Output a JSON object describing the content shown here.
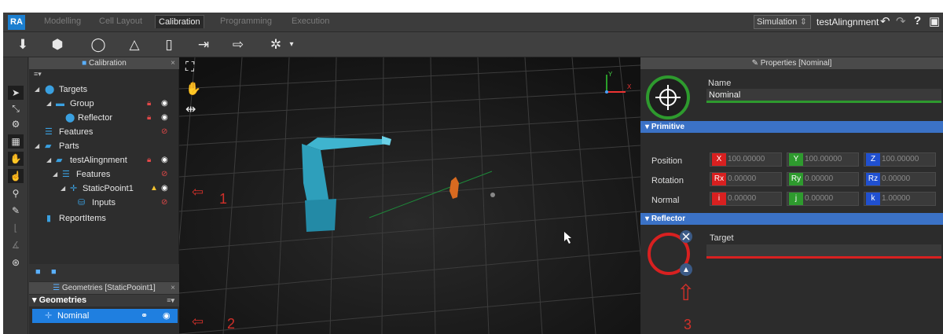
{
  "app": {
    "logo": "RA"
  },
  "tabs": [
    "Modelling",
    "Cell Layout",
    "Calibration",
    "Programming",
    "Execution"
  ],
  "active_tab": "Calibration",
  "mode_select": {
    "value": "Simulation"
  },
  "project_name": "testAlingnment",
  "calibration_panel": {
    "title": "Calibration",
    "tree": [
      {
        "label": "Targets",
        "level": 0
      },
      {
        "label": "Group",
        "level": 1
      },
      {
        "label": "Reflector",
        "level": 2
      },
      {
        "label": "Features",
        "level": 1
      },
      {
        "label": "Parts",
        "level": 0
      },
      {
        "label": "testAlingnment",
        "level": 1
      },
      {
        "label": "Features",
        "level": 2
      },
      {
        "label": "StaticPooint1",
        "level": 3
      },
      {
        "label": "Inputs",
        "level": 4
      },
      {
        "label": "ReportItems",
        "level": 1
      }
    ]
  },
  "geometries_panel": {
    "title": "Geometries [StaticPooint1]",
    "section": "Geometries",
    "items": [
      {
        "label": "Nominal"
      }
    ]
  },
  "properties": {
    "title": "Properties [Nominal]",
    "name_label": "Name",
    "name_value": "Nominal",
    "primitive": {
      "title": "Primitive",
      "position": {
        "label": "Position",
        "x": "100.00000",
        "y": "100.00000",
        "z": "100.00000"
      },
      "rotation": {
        "label": "Rotation",
        "rx": "0.00000",
        "ry": "0.00000",
        "rz": "0.00000"
      },
      "normal": {
        "label": "Normal",
        "i": "0.00000",
        "j": "0.00000",
        "k": "1.00000"
      }
    },
    "reflector": {
      "title": "Reflector",
      "target_label": "Target"
    }
  },
  "annotations": [
    "1",
    "2",
    "3"
  ],
  "colors": {
    "accent": "#1f7fe0",
    "section": "#3b72c6",
    "annotation": "#d0302a",
    "green": "#2e9a2e",
    "red": "#d82020"
  }
}
